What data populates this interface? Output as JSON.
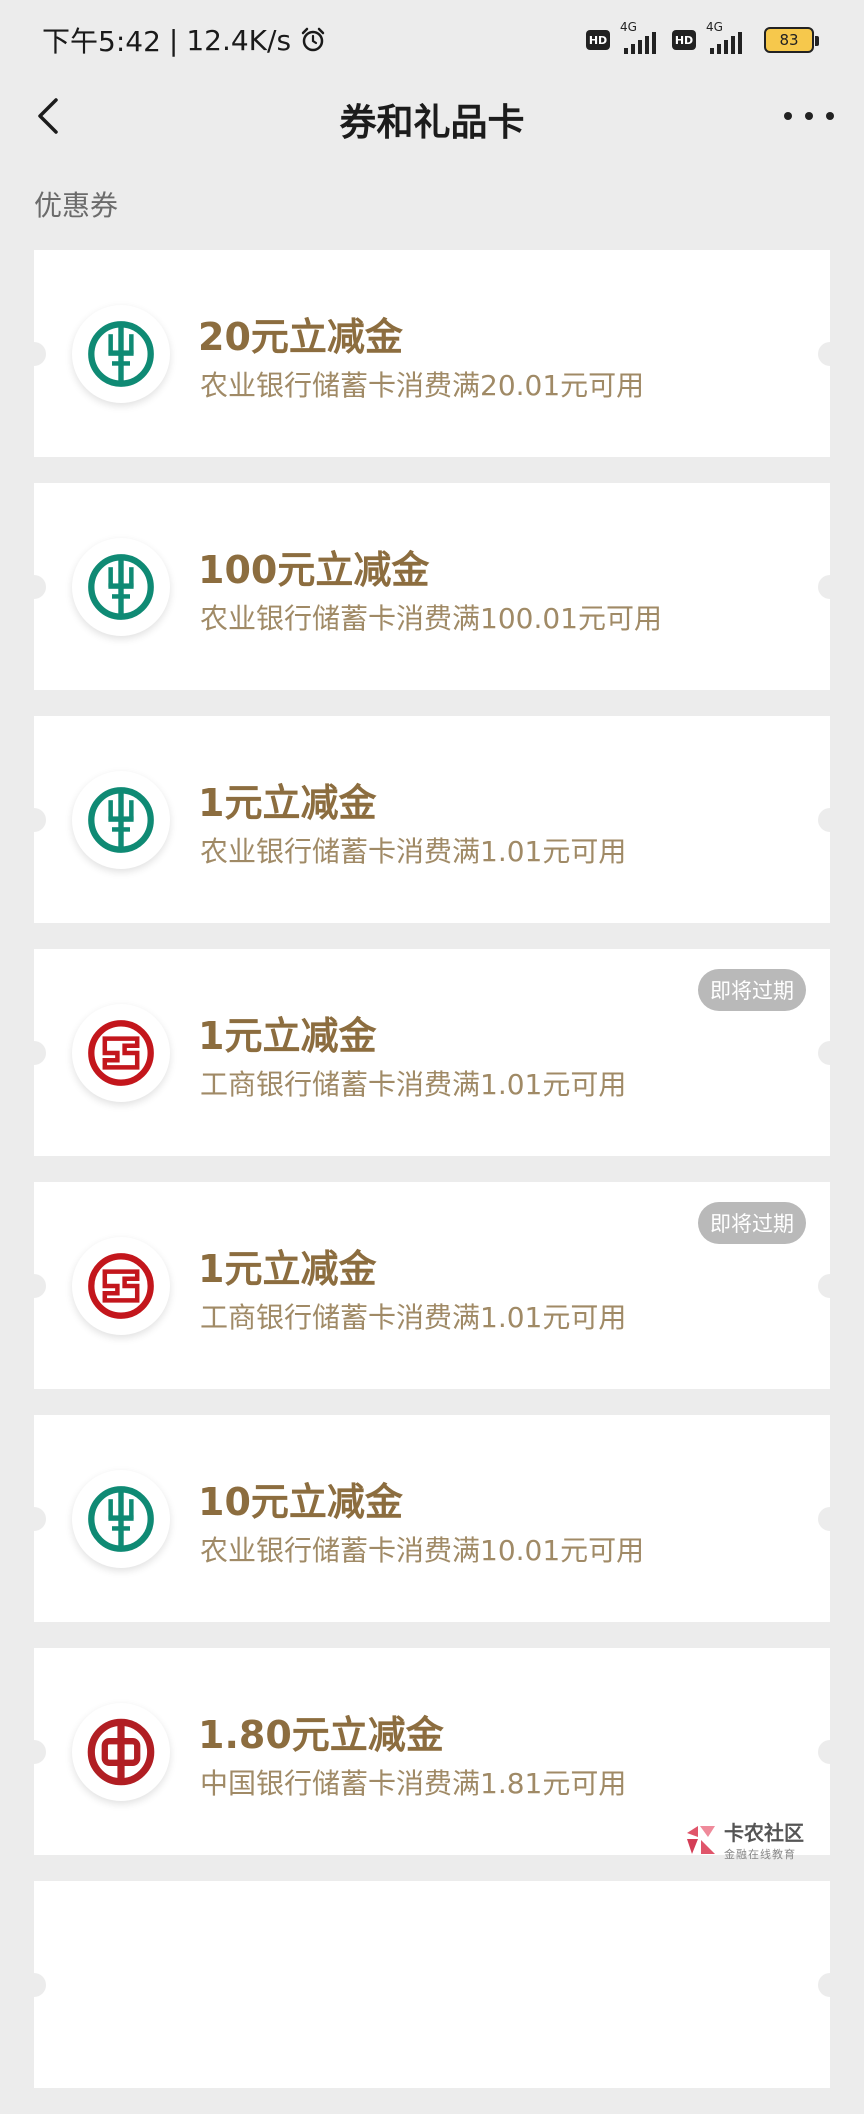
{
  "status_bar": {
    "time": "下午5:42",
    "separator": "|",
    "speed": "12.4K/s",
    "hd1": "HD",
    "net1": "4G",
    "hd2": "HD",
    "net2": "4G",
    "battery": "83"
  },
  "header": {
    "title": "券和礼品卡"
  },
  "section": {
    "label": "优惠券"
  },
  "coupons": [
    {
      "bank": "abc",
      "title": "20元立减金",
      "desc": "农业银行储蓄卡消费满20.01元可用",
      "badge": ""
    },
    {
      "bank": "abc",
      "title": "100元立减金",
      "desc": "农业银行储蓄卡消费满100.01元可用",
      "badge": ""
    },
    {
      "bank": "abc",
      "title": "1元立减金",
      "desc": "农业银行储蓄卡消费满1.01元可用",
      "badge": ""
    },
    {
      "bank": "icbc",
      "title": "1元立减金",
      "desc": "工商银行储蓄卡消费满1.01元可用",
      "badge": "即将过期"
    },
    {
      "bank": "icbc",
      "title": "1元立减金",
      "desc": "工商银行储蓄卡消费满1.01元可用",
      "badge": "即将过期"
    },
    {
      "bank": "abc",
      "title": "10元立减金",
      "desc": "农业银行储蓄卡消费满10.01元可用",
      "badge": ""
    },
    {
      "bank": "boc",
      "title": "1.80元立减金",
      "desc": "中国银行储蓄卡消费满1.81元可用",
      "badge": ""
    },
    {
      "bank": "",
      "title": "",
      "desc": "",
      "badge": ""
    }
  ],
  "watermark": {
    "main": "卡农社区",
    "sub": "金融在线教育"
  },
  "colors": {
    "page_bg": "#ececec",
    "coupon_title": "#8c6d3f",
    "coupon_desc": "#a08a66",
    "abc_green": "#0f8a74",
    "icbc_red": "#c3161c",
    "boc_red": "#b11e23",
    "badge_bg": "#b9b9b9"
  },
  "icons": {
    "back": "chevron-left-icon",
    "more": "more-dots-icon",
    "alarm": "alarm-clock-icon",
    "abc": "abc-bank-logo",
    "icbc": "icbc-bank-logo",
    "boc": "boc-bank-logo"
  }
}
